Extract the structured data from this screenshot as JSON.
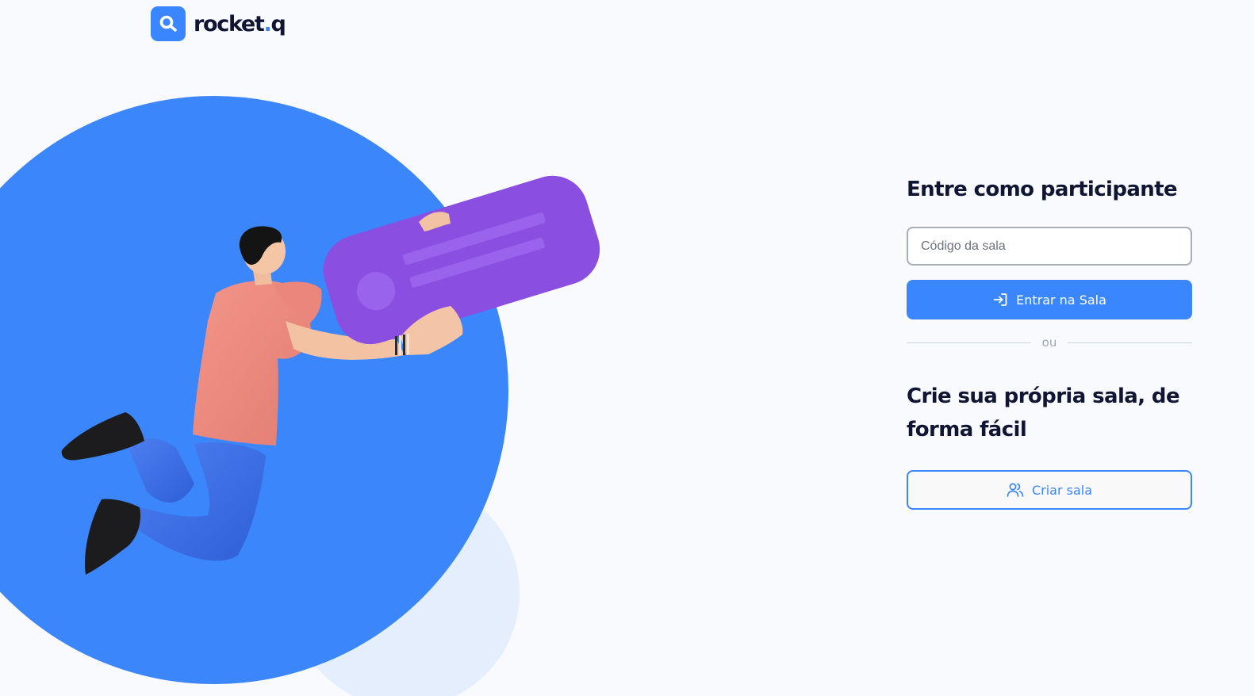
{
  "brand": {
    "name_main": "rocket",
    "name_dot": ".",
    "name_suffix": "q",
    "color": "#3a86ff",
    "icon": "search-icon"
  },
  "illustration": {
    "description_icon": "person-holding-card-illustration"
  },
  "join": {
    "title": "Entre como participante",
    "input_placeholder": "Código da sala",
    "input_value": "",
    "button_label": "Entrar na Sala",
    "button_icon": "login-icon"
  },
  "divider": {
    "label": "ou"
  },
  "create": {
    "title": "Crie sua própria sala, de forma fácil",
    "button_label": "Criar sala",
    "button_icon": "users-icon"
  },
  "colors": {
    "accent": "#3a86ff",
    "heading": "#0f1533",
    "background": "#f8fafd",
    "card_purple": "#8a4fe0"
  }
}
